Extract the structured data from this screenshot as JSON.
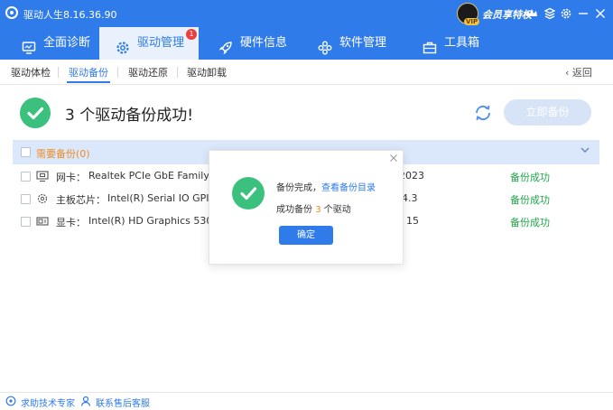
{
  "window": {
    "title": "驱动人生8.16.36.90",
    "vip_label": "会员享特权",
    "vip_badge": "VIP",
    "controls": {
      "crown": "crown-icon",
      "menu": "menu-icon",
      "settings": "gear-icon",
      "minimize": "minimize-icon",
      "close": "close-icon"
    }
  },
  "nav": {
    "items": [
      {
        "label": "全面诊断",
        "icon": "monitor-icon"
      },
      {
        "label": "驱动管理",
        "icon": "gear-icon",
        "badge": "1"
      },
      {
        "label": "硬件信息",
        "icon": "rocket-icon"
      },
      {
        "label": "软件管理",
        "icon": "apps-icon"
      },
      {
        "label": "工具箱",
        "icon": "toolbox-icon"
      }
    ],
    "active_index": 1
  },
  "subnav": {
    "items": [
      "驱动体检",
      "驱动备份",
      "驱动还原",
      "驱动卸载"
    ],
    "active_index": 1,
    "back_label": "返回"
  },
  "headline": "3 个驱动备份成功!",
  "backup_button": "立即备份",
  "group": {
    "label": "需要备份(0)"
  },
  "rows": [
    {
      "category": "网卡：",
      "name": "Realtek PCIe GbE Family C",
      "version": "2023",
      "status": "备份成功",
      "icon": "network-card-icon"
    },
    {
      "category": "主板芯片：",
      "name": "Intel(R) Serial IO GPIO",
      "version": "4.3",
      "status": "备份成功",
      "icon": "chipset-icon"
    },
    {
      "category": "显卡：",
      "name": "Intel(R) HD Graphics 530",
      "version": "15",
      "status": "备份成功",
      "icon": "graphics-card-icon"
    }
  ],
  "dialog": {
    "line1_prefix": "备份完成，",
    "line1_link": "查看备份目录",
    "line2_prefix": "成功备份",
    "line2_count": "3",
    "line2_suffix": "个驱动",
    "ok_label": "确定"
  },
  "footer": {
    "help_label": "求助技术专家",
    "service_label": "联系售后客服"
  },
  "colors": {
    "accent": "#2f7bea",
    "success": "#3bc17d",
    "warning": "#f08a20"
  }
}
